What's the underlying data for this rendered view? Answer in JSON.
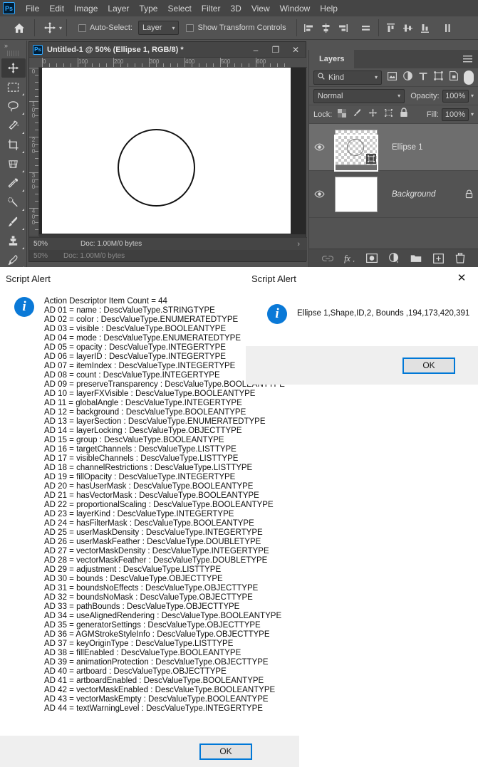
{
  "app": {
    "logo": "Ps",
    "menu": [
      "File",
      "Edit",
      "Image",
      "Layer",
      "Type",
      "Select",
      "Filter",
      "3D",
      "View",
      "Window",
      "Help"
    ]
  },
  "options_bar": {
    "home_icon": "home-icon",
    "tool_icon": "move-tool-icon",
    "auto_select_label": "Auto-Select:",
    "auto_select_checked": false,
    "layer_dropdown_value": "Layer",
    "show_transform_label": "Show Transform Controls",
    "show_transform_checked": false,
    "align_icons": [
      "align-left-edges-icon",
      "align-horizontal-centers-icon",
      "align-right-edges-icon",
      "align-middle-icon",
      "align-top-edges-icon",
      "align-vertical-centers-icon",
      "align-bottom-edges-icon",
      "distribute-icon"
    ]
  },
  "toolbar": {
    "collapse_label": "»",
    "tools": [
      {
        "name": "move-tool",
        "glyph": "✥",
        "active": true,
        "has_flyout": false
      },
      {
        "name": "rectangular-marquee-tool",
        "glyph": "⬚",
        "active": false,
        "has_flyout": true
      },
      {
        "name": "lasso-tool",
        "glyph": "⥁",
        "active": false,
        "has_flyout": true
      },
      {
        "name": "magic-wand-tool",
        "glyph": "✨",
        "active": false,
        "has_flyout": true
      },
      {
        "name": "crop-tool",
        "glyph": "⌗",
        "active": false,
        "has_flyout": true
      },
      {
        "name": "perspective-crop-tool",
        "glyph": "▦",
        "active": false,
        "has_flyout": true
      },
      {
        "name": "eyedropper-tool",
        "glyph": "✒",
        "active": false,
        "has_flyout": true
      },
      {
        "name": "spot-healing-brush-tool",
        "glyph": "☂",
        "active": false,
        "has_flyout": true
      },
      {
        "name": "brush-tool",
        "glyph": "✎",
        "active": false,
        "has_flyout": true
      },
      {
        "name": "clone-stamp-tool",
        "glyph": "♟",
        "active": false,
        "has_flyout": true
      },
      {
        "name": "history-brush-tool",
        "glyph": "✐",
        "active": false,
        "has_flyout": true
      }
    ]
  },
  "document": {
    "logo": "Ps",
    "title": "Untitled-1 @ 50% (Ellipse 1, RGB/8) *",
    "window_buttons": {
      "minimize": "–",
      "maximize": "❐",
      "close": "✕"
    },
    "ruler_h_labels": [
      "0",
      "100",
      "200",
      "300",
      "400",
      "500",
      "600"
    ],
    "ruler_v_labels": [
      "0",
      "100",
      "200",
      "300",
      "400"
    ],
    "status_zoom": "50%",
    "status_doc": "Doc: 1.00M/0 bytes",
    "status_arrow": "›",
    "status_secondary": "Doc: 1.00M/0 bytes"
  },
  "layers_panel": {
    "tab_label": "Layers",
    "menu_icon": "panel-menu-icon",
    "filter": {
      "search_icon": "search-icon",
      "kind_label": "Kind",
      "chevron": "∨",
      "type_icons": [
        "pixel-filter-icon",
        "adjustment-filter-icon",
        "type-filter-icon",
        "shape-filter-icon",
        "smart-object-filter-icon"
      ],
      "toggle_name": "filter-enable-toggle"
    },
    "blend_mode": "Normal",
    "blend_chevron": "∨",
    "opacity_label": "Opacity:",
    "opacity_value": "100%",
    "lock_label": "Lock:",
    "lock_icons": [
      "lock-transparent-pixels-icon",
      "lock-image-pixels-icon",
      "lock-position-icon",
      "lock-artboard-nesting-icon",
      "lock-all-icon"
    ],
    "fill_label": "Fill:",
    "fill_value": "100%",
    "layers": [
      {
        "name": "Ellipse 1",
        "visible": true,
        "selected": true,
        "italic": false,
        "locked": false,
        "thumb_type": "checker-shape",
        "vector_mask_icon": "vector-mask-icon"
      },
      {
        "name": "Background",
        "visible": true,
        "selected": false,
        "italic": true,
        "locked": true,
        "thumb_type": "white",
        "lock_icon": "lock-icon"
      }
    ],
    "bottom_icons": [
      "link-layers-icon",
      "layer-style-fx-icon",
      "add-layer-mask-icon",
      "new-fill-adjustment-icon",
      "new-group-icon",
      "new-layer-icon",
      "delete-layer-icon"
    ]
  },
  "dialogs": [
    {
      "id": "descriptor",
      "title": "Script Alert",
      "has_close": false,
      "icon": "info-icon",
      "message": "Action Descriptor Item Count = 44\nAD 01 = name : DescValueType.STRINGTYPE\nAD 02 = color : DescValueType.ENUMERATEDTYPE\nAD 03 = visible : DescValueType.BOOLEANTYPE\nAD 04 = mode : DescValueType.ENUMERATEDTYPE\nAD 05 = opacity : DescValueType.INTEGERTYPE\nAD 06 = layerID : DescValueType.INTEGERTYPE\nAD 07 = itemIndex : DescValueType.INTEGERTYPE\nAD 08 = count : DescValueType.INTEGERTYPE\nAD 09 = preserveTransparency : DescValueType.BOOLEANTYPE\nAD 10 = layerFXVisible : DescValueType.BOOLEANTYPE\nAD 11 = globalAngle : DescValueType.INTEGERTYPE\nAD 12 = background : DescValueType.BOOLEANTYPE\nAD 13 = layerSection : DescValueType.ENUMERATEDTYPE\nAD 14 = layerLocking : DescValueType.OBJECTTYPE\nAD 15 = group : DescValueType.BOOLEANTYPE\nAD 16 = targetChannels : DescValueType.LISTTYPE\nAD 17 = visibleChannels : DescValueType.LISTTYPE\nAD 18 = channelRestrictions : DescValueType.LISTTYPE\nAD 19 = fillOpacity : DescValueType.INTEGERTYPE\nAD 20 = hasUserMask : DescValueType.BOOLEANTYPE\nAD 21 = hasVectorMask : DescValueType.BOOLEANTYPE\nAD 22 = proportionalScaling : DescValueType.BOOLEANTYPE\nAD 23 = layerKind : DescValueType.INTEGERTYPE\nAD 24 = hasFilterMask : DescValueType.BOOLEANTYPE\nAD 25 = userMaskDensity : DescValueType.INTEGERTYPE\nAD 26 = userMaskFeather : DescValueType.DOUBLETYPE\nAD 27 = vectorMaskDensity : DescValueType.INTEGERTYPE\nAD 28 = vectorMaskFeather : DescValueType.DOUBLETYPE\nAD 29 = adjustment : DescValueType.LISTTYPE\nAD 30 = bounds : DescValueType.OBJECTTYPE\nAD 31 = boundsNoEffects : DescValueType.OBJECTTYPE\nAD 32 = boundsNoMask : DescValueType.OBJECTTYPE\nAD 33 = pathBounds : DescValueType.OBJECTTYPE\nAD 34 = useAlignedRendering : DescValueType.BOOLEANTYPE\nAD 35 = generatorSettings : DescValueType.OBJECTTYPE\nAD 36 = AGMStrokeStyleInfo : DescValueType.OBJECTTYPE\nAD 37 = keyOriginType : DescValueType.LISTTYPE\nAD 38 = fillEnabled : DescValueType.BOOLEANTYPE\nAD 39 = animationProtection : DescValueType.OBJECTTYPE\nAD 40 = artboard : DescValueType.OBJECTTYPE\nAD 41 = artboardEnabled : DescValueType.BOOLEANTYPE\nAD 42 = vectorMaskEnabled : DescValueType.BOOLEANTYPE\nAD 43 = vectorMaskEmpty : DescValueType.BOOLEANTYPE\nAD 44 = textWarningLevel : DescValueType.INTEGERTYPE",
      "ok_label": "OK"
    },
    {
      "id": "bounds",
      "title": "Script Alert",
      "has_close": true,
      "close_glyph": "✕",
      "icon": "info-icon",
      "message": "Ellipse 1,Shape,ID,2, Bounds ,194,173,420,391",
      "ok_label": "OK"
    }
  ],
  "colors": {
    "app_bg": "#535353",
    "panel_bg": "#454545",
    "accent_blue": "#0078d7",
    "info_blue": "#0a79d7",
    "dialog_bg": "#ffffff",
    "dialog_footer": "#efefef",
    "ps_brand": "#31a8ff"
  }
}
